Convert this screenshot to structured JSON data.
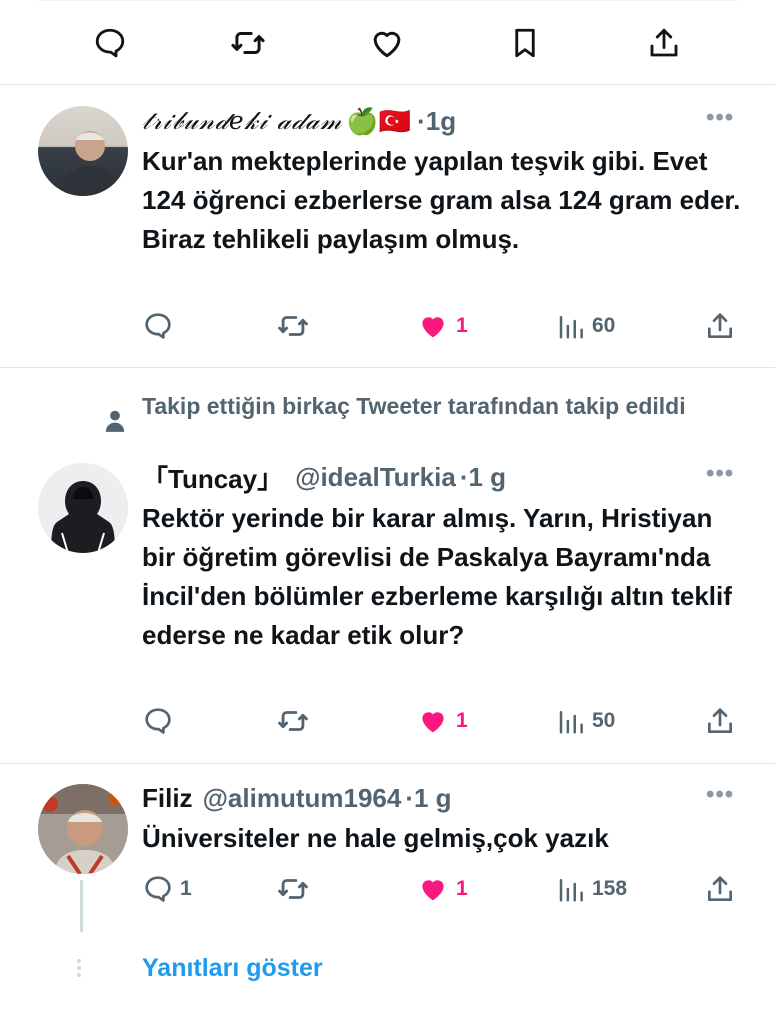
{
  "icons": {
    "reply": "reply-icon",
    "retweet": "retweet-icon",
    "like": "heart-icon",
    "bookmark": "bookmark-icon",
    "share": "share-icon",
    "views": "views-icon",
    "more": "more-icon",
    "person": "person-icon"
  },
  "colors": {
    "like_active": "#f91880",
    "link": "#1d9bf0",
    "muted": "#536471",
    "divider": "#e1e6e9"
  },
  "tweets": [
    {
      "display_name": "𝓉𝓇𝒾𝒷𝓊𝓃𝒹𝑒𝓀𝒾 𝒶𝒹𝒶𝓂",
      "emoji": "🍏🇹🇷",
      "time": "·1g",
      "text": "Kur'an mekteplerinde yapılan teşvik gibi. Evet 124 öğrenci ezberlerse gram alsa 124 gram eder. Biraz tehlikeli paylaşım olmuş.",
      "likes": "1",
      "views": "60"
    },
    {
      "social_context": "Takip ettiğin birkaç Tweeter tarafından takip edildi",
      "display_name": "「Tuncay」",
      "handle": "@idealTurkia",
      "time": "·1 g",
      "text": "Rektör yerinde bir karar almış. Yarın, Hristiyan bir öğretim görevlisi de Paskalya Bayramı'nda İncil'den bölümler ezberleme karşılığı altın teklif ederse ne kadar etik olur?",
      "likes": "1",
      "views": "50"
    },
    {
      "display_name": "Filiz",
      "handle": "@alimutum1964",
      "time": "·1 g",
      "text": "Üniversiteler ne hale gelmiş,çok yazık",
      "replies": "1",
      "likes": "1",
      "views": "158"
    }
  ],
  "show_replies_label": "Yanıtları göster"
}
